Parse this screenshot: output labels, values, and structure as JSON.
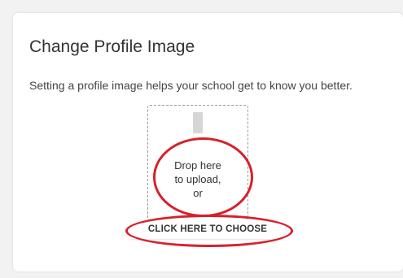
{
  "card": {
    "title": "Change Profile Image",
    "description": "Setting a profile image helps your school get to know you better."
  },
  "dropzone": {
    "line1": "Drop here",
    "line2": "to upload,",
    "line3": "or",
    "icon": "image-placeholder-icon"
  },
  "choose_button": {
    "label": "CLICK HERE TO CHOOSE"
  },
  "colors": {
    "annotation": "#d8202a",
    "card_bg": "#ffffff",
    "page_bg": "#f2f2f2"
  }
}
